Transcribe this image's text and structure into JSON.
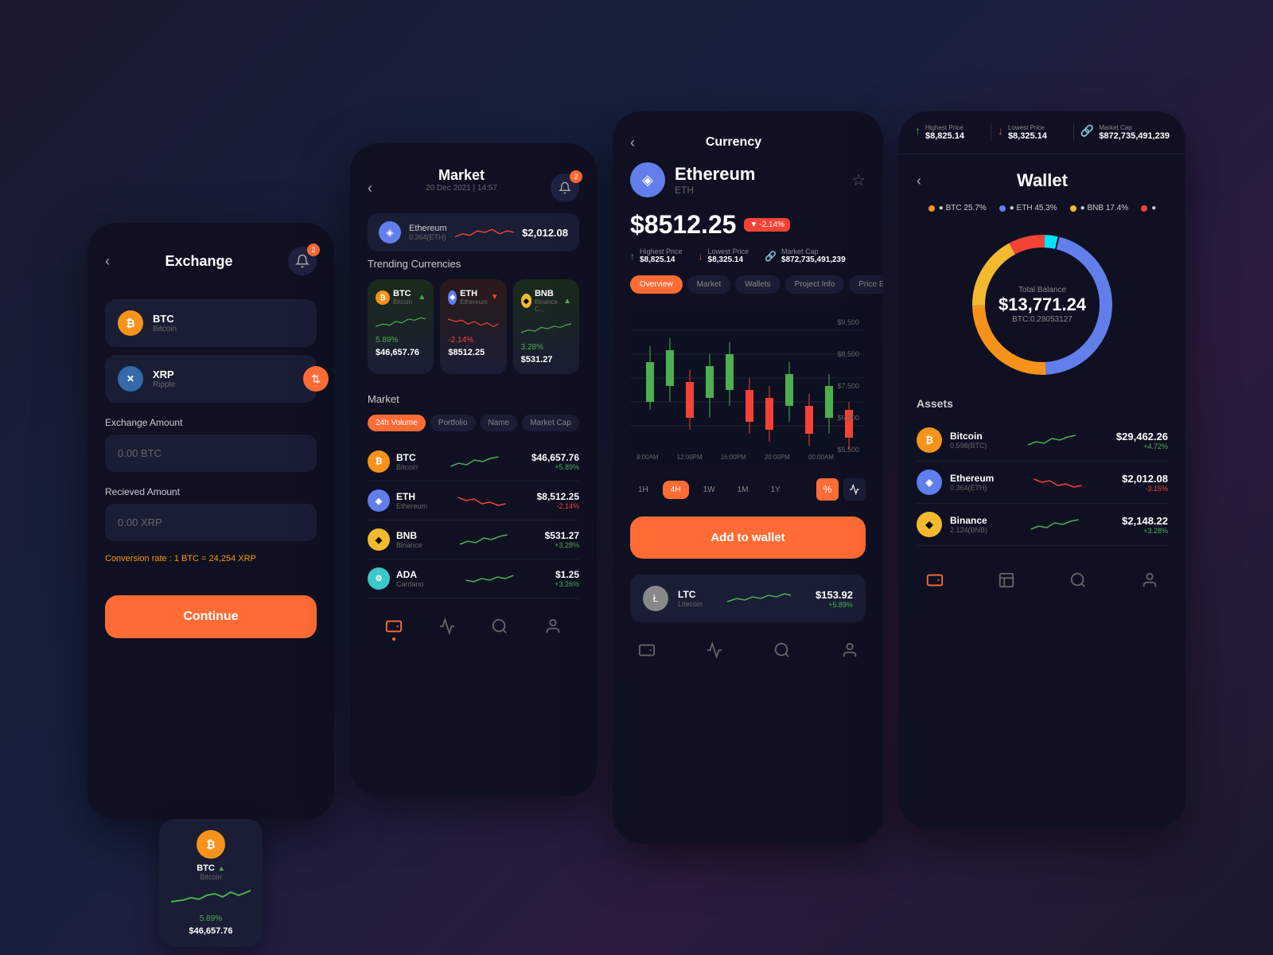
{
  "exchange": {
    "title": "Exchange",
    "notification_count": "2",
    "coin1": {
      "name": "BTC",
      "full": "Bitcoin",
      "type": "btc"
    },
    "coin2": {
      "name": "XRP",
      "full": "Ripple",
      "type": "xrp"
    },
    "exchange_amount_label": "Exchange Amount",
    "exchange_amount_placeholder": "0.00 BTC",
    "received_amount_label": "Recieved Amount",
    "received_amount_placeholder": "0.00 XRP",
    "conversion_rate": "Conversion rate : 1 BTC = 24,254 XRP",
    "continue_btn": "Continue"
  },
  "btc_mini": {
    "name": "BTC",
    "full": "Bitcoin",
    "pct": "5.89%",
    "price": "$46,657.76"
  },
  "market": {
    "title": "Market",
    "date": "20 Dec 2021 | 14:57",
    "notification_count": "2",
    "trending_label": "Trending Currencies",
    "trending": [
      {
        "name": "BTC",
        "full": "Bitcoin",
        "type": "btc",
        "pct": "5.89%",
        "pct_dir": "up",
        "price": "$46,657.76",
        "arrow": "up"
      },
      {
        "name": "ETH",
        "full": "Ethereum",
        "type": "eth",
        "pct": "-2.14%",
        "pct_dir": "down",
        "price": "$8512.25",
        "arrow": "down"
      },
      {
        "name": "BNB",
        "full": "Binance C...",
        "type": "bnb",
        "pct": "3.28%",
        "pct_dir": "up",
        "price": "$531.27",
        "arrow": "up"
      }
    ],
    "market_label": "Market",
    "filters": [
      "24h Volume",
      "Portfolio",
      "Name",
      "Market Cap"
    ],
    "active_filter": "24h Volume",
    "coins": [
      {
        "name": "BTC",
        "full": "Bitcoin",
        "type": "btc",
        "price": "$46,657.76",
        "chg": "+5.89%",
        "dir": "up"
      },
      {
        "name": "ETH",
        "full": "Ethereum",
        "type": "eth",
        "price": "$8,512.25",
        "chg": "-2.14%",
        "dir": "down"
      },
      {
        "name": "BNB",
        "full": "Binance",
        "type": "bnb",
        "price": "$531.27",
        "chg": "+3.28%",
        "dir": "up"
      },
      {
        "name": "ADA",
        "full": "Cardano",
        "type": "ada",
        "price": "$1.25",
        "chg": "+3.26%",
        "dir": "up"
      }
    ],
    "nav": [
      "wallet",
      "chart",
      "search",
      "user"
    ]
  },
  "currency": {
    "title": "Currency",
    "coin_name": "Ethereum",
    "coin_sym": "ETH",
    "price": "$8512.25",
    "change": "-2.14%",
    "highest_price_label": "Highest Price",
    "highest_price": "$8,825.14",
    "lowest_price_label": "Lowest Price",
    "lowest_price": "$8,325.14",
    "market_cap_label": "Market Cap",
    "market_cap": "$872,735,491,239",
    "tabs": [
      "Overview",
      "Market",
      "Wallets",
      "Project Info",
      "Price Estimate"
    ],
    "active_tab": "Overview",
    "time_filters": [
      "1H",
      "4H",
      "1W",
      "1M",
      "1Y"
    ],
    "active_time": "4H",
    "chart_y": [
      "$9,500",
      "$8,500",
      "$7,500",
      "$6,500",
      "$5,500"
    ],
    "chart_x": [
      "8:00AM",
      "12:00PM",
      "16:00PM",
      "20:00PM",
      "00:00AM"
    ],
    "add_wallet_btn": "Add to wallet",
    "ltc": {
      "name": "LTC",
      "full": "Litecoin",
      "price": "$153.92",
      "chg": "+5.89%"
    }
  },
  "wallet": {
    "title": "Wallet",
    "stats": {
      "highest_label": "Highest Price",
      "highest_val": "$8,825.14",
      "lowest_label": "Lowest Price",
      "lowest_val": "$8,325.14",
      "mcap_label": "Market Cap",
      "mcap_val": "$872,735,491,239"
    },
    "legend": [
      {
        "color": "#f7931a",
        "label": "BTC",
        "pct": "25.7%"
      },
      {
        "color": "#627eea",
        "label": "ETH",
        "pct": "45.3%"
      },
      {
        "color": "#f3ba2f",
        "label": "BNB",
        "pct": "17.4%"
      },
      {
        "color": "#f44336",
        "label": "",
        "pct": ""
      }
    ],
    "total_label": "Total Balance",
    "total_value": "$13,771.24",
    "total_sub": "BTC:0.28053127",
    "assets_label": "Assets",
    "assets": [
      {
        "name": "Bitcoin",
        "sub": "0.598(BTC)",
        "type": "btc",
        "price": "$29,462.26",
        "chg": "+4.72%",
        "dir": "up"
      },
      {
        "name": "Ethereum",
        "sub": "0.364(ETH)",
        "type": "eth",
        "price": "$2,012.08",
        "chg": "-3.15%",
        "dir": "down"
      },
      {
        "name": "Binance",
        "sub": "2.124(BNB)",
        "type": "bnb",
        "price": "$2,148.22",
        "chg": "+3.28%",
        "dir": "up"
      }
    ],
    "eth_mini": {
      "name": "Ethereum",
      "sub": "0.364(ETH)",
      "price": "$2,012.08"
    }
  }
}
